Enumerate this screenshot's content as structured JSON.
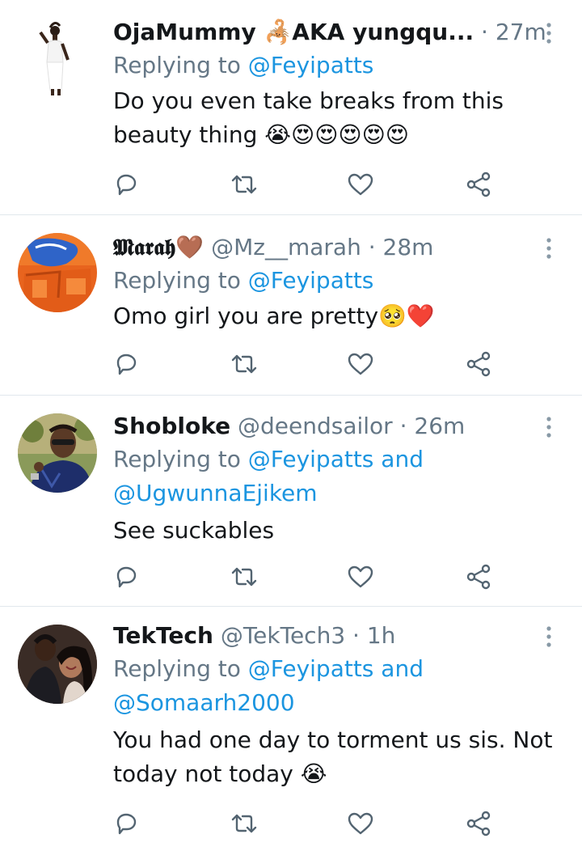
{
  "colors": {
    "link": "#1b95e0",
    "muted": "#657786",
    "text": "#14171a",
    "divider": "#e1e8ed"
  },
  "tweets": [
    {
      "name": "OjaMummy 🦂AKA yungqu...",
      "handle": "",
      "sep": "·",
      "time": "27m",
      "reply_prefix": "Replying to",
      "mentions_line1": "@Feyipatts",
      "mentions_line2": "",
      "text_line1": "Do you even take breaks from this",
      "text_line2": "beauty thing",
      "emojis": "😭😍😍😍😍😍",
      "avatar_icon": "avatar-woman-white-dress"
    },
    {
      "name": "𝕸𝖆𝖗𝖆𝖍🤎",
      "handle": "@Mz__marah",
      "sep": "·",
      "time": "28m",
      "reply_prefix": "Replying to",
      "mentions_line1": "@Feyipatts",
      "mentions_line2": "",
      "text_line1": "Omo girl you are pretty",
      "text_line2": "",
      "emojis": "🥺❤️",
      "avatar_icon": "avatar-orange-blue"
    },
    {
      "name": "Shobloke",
      "handle": "@deendsailor",
      "sep": "·",
      "time": "26m",
      "reply_prefix": "Replying to",
      "mentions_line1": "@Feyipatts and",
      "mentions_line2": "@UgwunnaEjikem",
      "text_line1": "See suckables",
      "text_line2": "",
      "emojis": "",
      "avatar_icon": "avatar-man-sunglasses"
    },
    {
      "name": "TekTech",
      "handle": "@TekTech3",
      "sep": "·",
      "time": "1h",
      "reply_prefix": "Replying to",
      "mentions_line1": "@Feyipatts and",
      "mentions_line2": "@Somaarh2000",
      "text_line1": "You had one day to torment us sis. Not",
      "text_line2": "today not today",
      "emojis": "😭",
      "avatar_icon": "avatar-couple"
    }
  ],
  "action_icons": [
    "reply-icon",
    "retweet-icon",
    "like-icon",
    "share-icon"
  ]
}
